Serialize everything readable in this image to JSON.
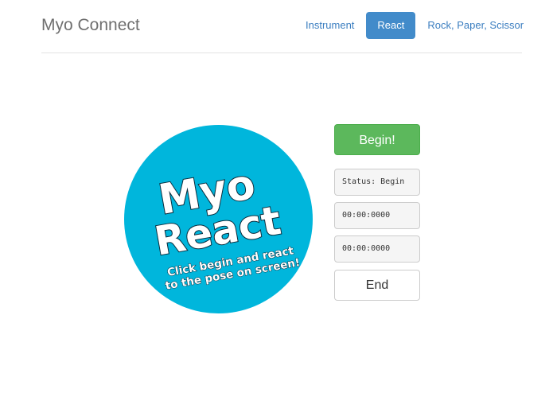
{
  "header": {
    "brand": "Myo Connect",
    "nav": [
      {
        "label": "Instrument",
        "active": false
      },
      {
        "label": "React",
        "active": true
      },
      {
        "label": "Rock, Paper, Scissor",
        "active": false
      }
    ]
  },
  "logo": {
    "line1": "Myo",
    "line2": "React",
    "caption1": "Click begin and react",
    "caption2": "to the pose on screen!",
    "circle_color": "#00b6dc"
  },
  "controls": {
    "begin_label": "Begin!",
    "status": "Status: Begin",
    "timer1": "00:00:0000",
    "timer2": "00:00:0000",
    "end_label": "End"
  },
  "colors": {
    "primary": "#428bca",
    "success": "#5cb85c",
    "link": "#3b7ec0"
  }
}
